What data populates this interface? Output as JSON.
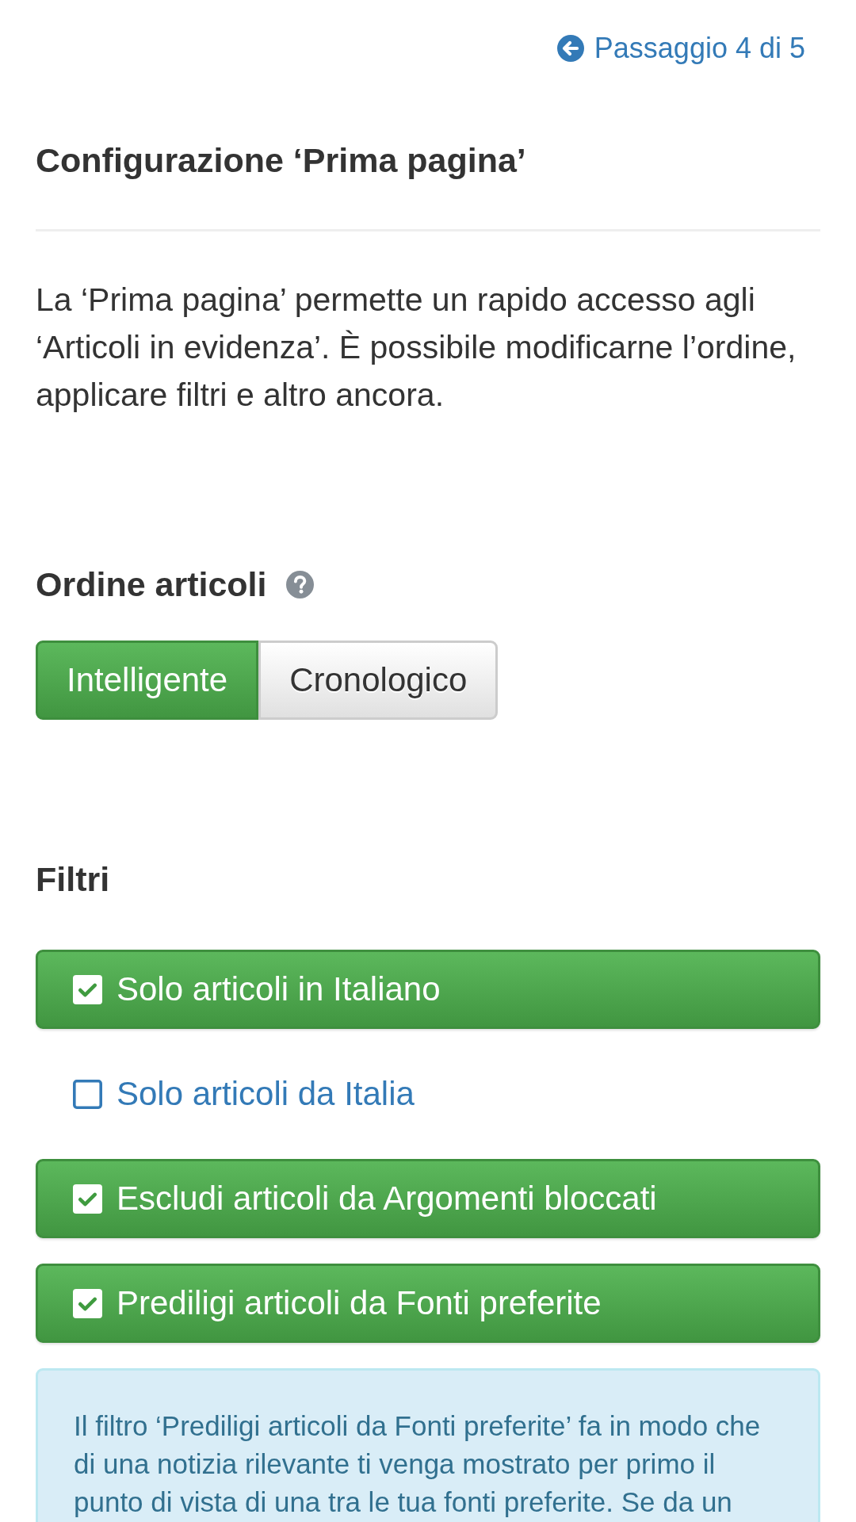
{
  "step_link": {
    "label": "Passaggio 4 di 5"
  },
  "title": "Configurazione ‘Prima pagina’",
  "intro": "La ‘Prima pagina’ permette un rapido accesso agli ‘Articoli in evidenza’. È possibile modificarne l’ordine, applicare filtri e altro ancora.",
  "sort_order": {
    "heading": "Ordine articoli",
    "options": [
      {
        "label": "Intelligente",
        "selected": true
      },
      {
        "label": "Cronologico",
        "selected": false
      }
    ]
  },
  "filters": {
    "heading": "Filtri",
    "items": [
      {
        "label": "Solo articoli in Italiano",
        "checked": true
      },
      {
        "label": "Solo articoli da Italia",
        "checked": false
      },
      {
        "label": "Escludi articoli da Argomenti bloccati",
        "checked": true
      },
      {
        "label": "Prediligi articoli da Fonti preferite",
        "checked": true
      }
    ]
  },
  "info": "Il filtro ‘Prediligi articoli da Fonti preferite’ fa in modo che di una notizia rilevante ti venga mostrato per primo il punto di vista di una tra le tua fonti preferite. Se da un"
}
